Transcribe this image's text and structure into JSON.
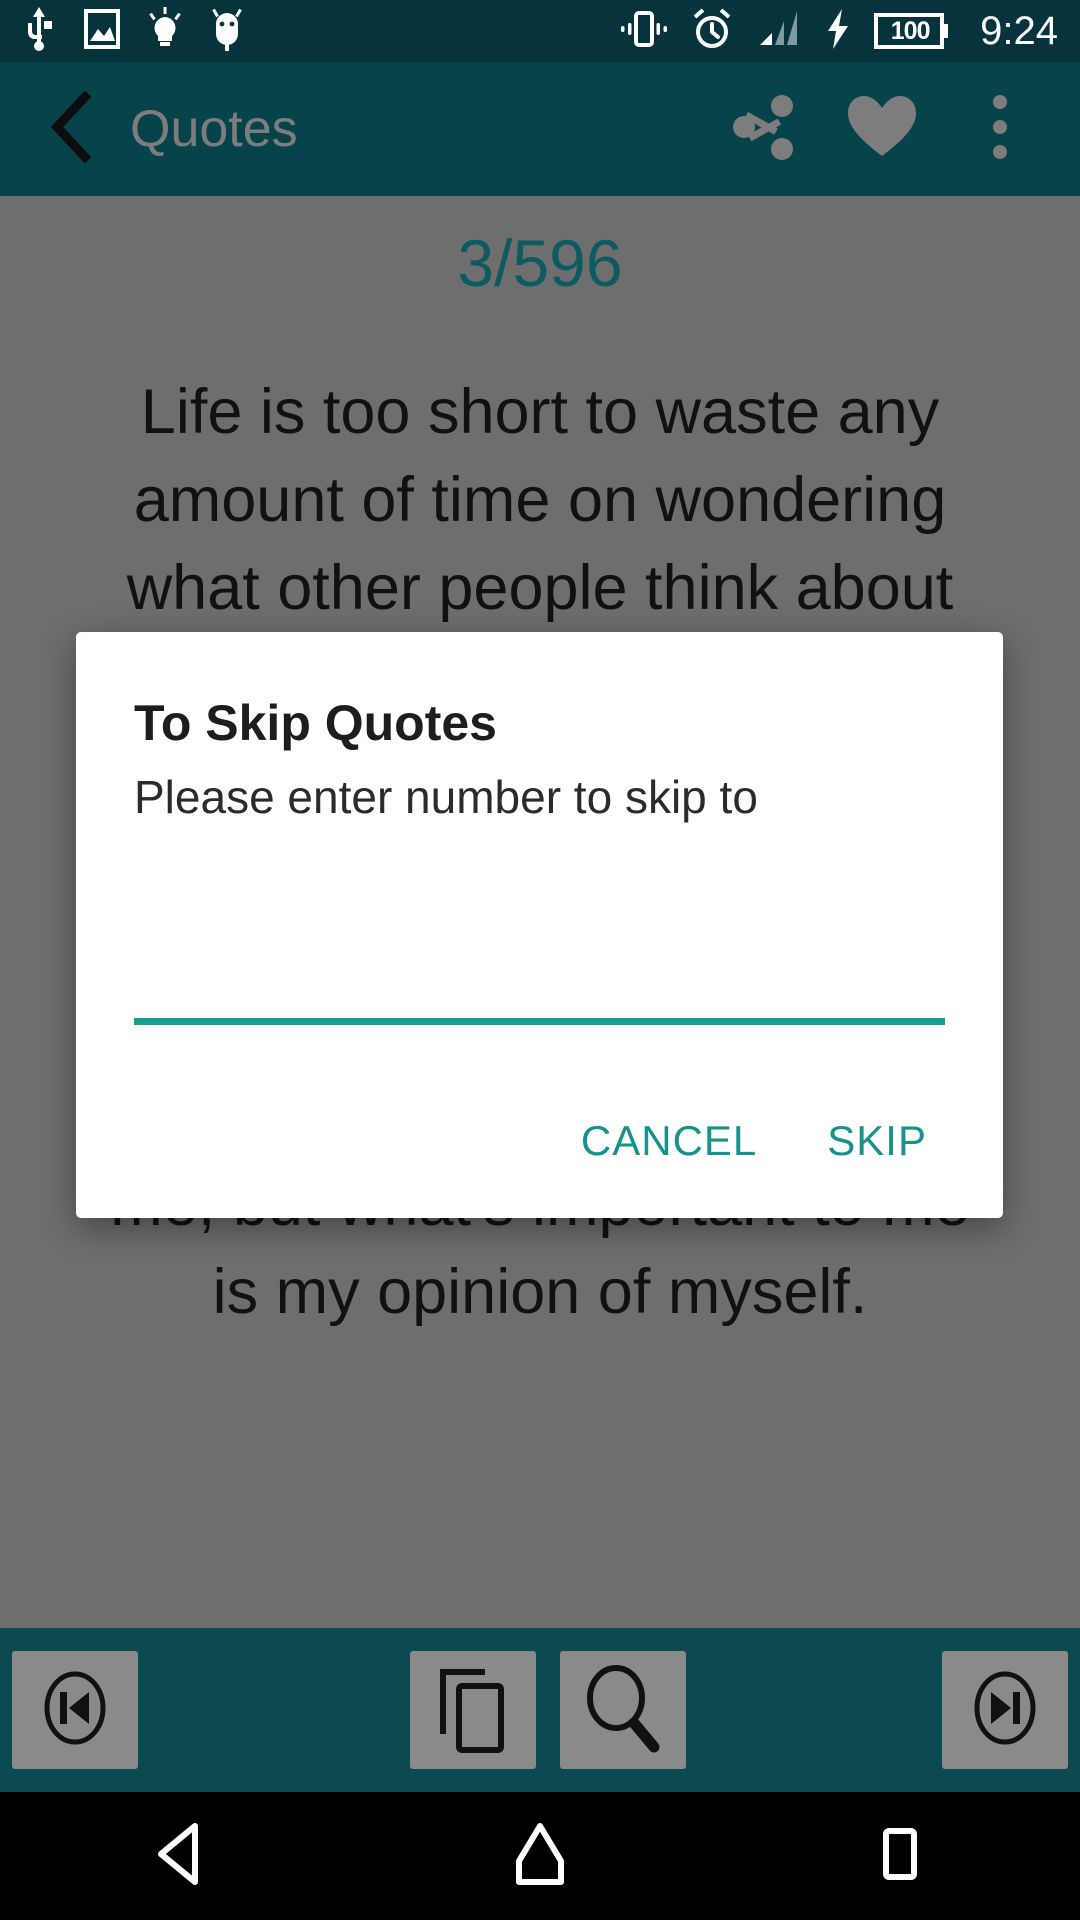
{
  "status_bar": {
    "background": "#07343c",
    "time": "9:24",
    "battery_level": "100",
    "icons": [
      "usb-icon",
      "screenshot-image-icon",
      "bulb-icon",
      "android-debug-icon",
      "vibrate-icon",
      "alarm-clock-icon",
      "signal-bars-icon",
      "charging-bolt-icon",
      "battery-icon"
    ]
  },
  "app_bar": {
    "background": "#07434b",
    "title": "Quotes",
    "title_color": "#7d7d7d",
    "back_icon": "chevron-left-icon",
    "actions": [
      {
        "name": "share-icon",
        "label": "Share"
      },
      {
        "name": "heart-icon",
        "label": "Favorite"
      },
      {
        "name": "overflow-menu-icon",
        "label": "More options"
      }
    ]
  },
  "content": {
    "background": "#6e6e6e",
    "counter": "3/596",
    "counter_color": "#0d5b60",
    "quote": "Life is too short to waste any amount of time on wondering what other people think about you. In the first place, if they had better things going on in their lives, they wouldn't have the time to sit around and talk about you. What's important to me is not others' opinions of me, but what's important to me is my opinion of myself."
  },
  "dialog": {
    "title": "To Skip Quotes",
    "message": "Please enter number to skip to",
    "input_value": "",
    "input_placeholder": "",
    "underline_color": "#17a092",
    "buttons": [
      {
        "name": "cancel-button",
        "label": "CANCEL"
      },
      {
        "name": "skip-button",
        "label": "SKIP"
      }
    ],
    "button_color": "#17928c"
  },
  "toolbar": {
    "background": "#0b4a50",
    "buttons": [
      {
        "name": "previous-quote-button",
        "icon": "skip-previous-icon",
        "label": "Previous"
      },
      {
        "name": "copy-quote-button",
        "icon": "copy-icon",
        "label": "Copy"
      },
      {
        "name": "search-quotes-button",
        "icon": "magnifier-icon",
        "label": "Search"
      },
      {
        "name": "next-quote-button",
        "icon": "skip-next-icon",
        "label": "Next"
      }
    ]
  },
  "nav_bar": {
    "background": "#000000",
    "buttons": [
      {
        "name": "nav-back-button",
        "icon": "triangle-back-icon"
      },
      {
        "name": "nav-home-button",
        "icon": "home-icon"
      },
      {
        "name": "nav-recents-button",
        "icon": "square-recents-icon"
      }
    ]
  }
}
